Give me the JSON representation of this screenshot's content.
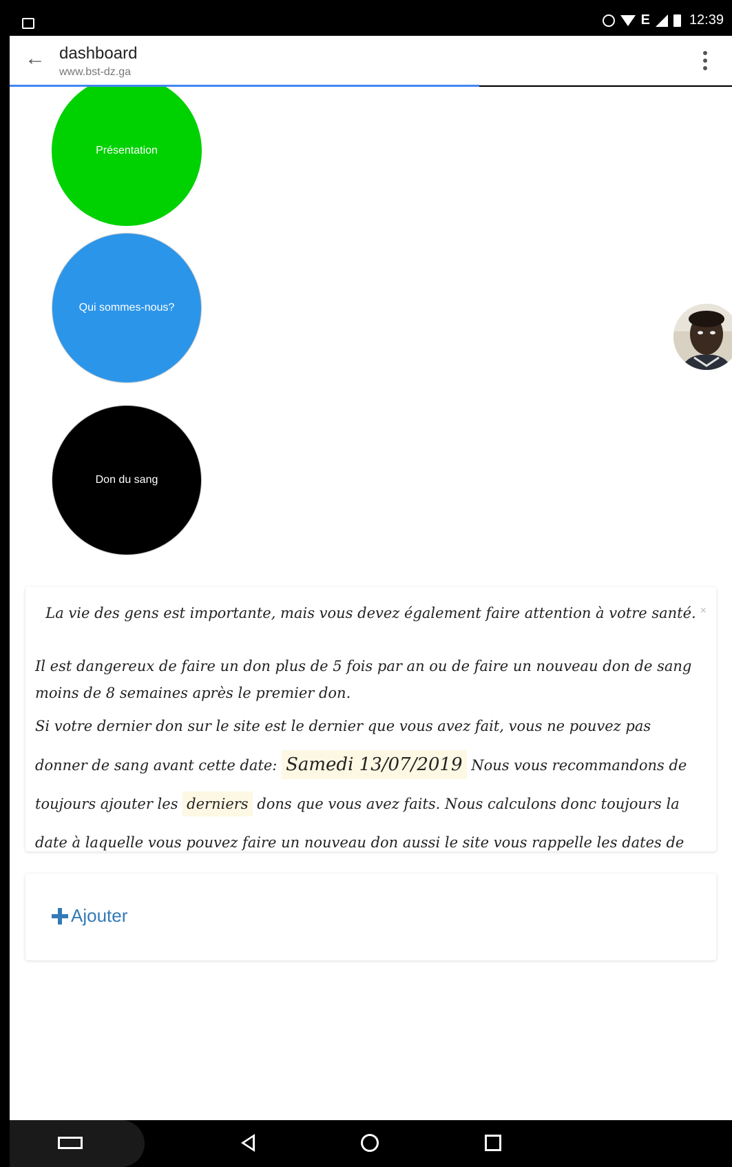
{
  "status_bar": {
    "network": "E",
    "time": "12:39"
  },
  "app_bar": {
    "title": "dashboard",
    "url": "www.bst-dz.ga"
  },
  "circles": {
    "presentation": "Présentation",
    "about": "Qui sommes-nous?",
    "donation": "Don du sang"
  },
  "colors": {
    "presentation": "#00d100",
    "about": "#2b95ea",
    "donation": "#000000",
    "link": "#337ab7",
    "highlight": "#fcf8e3",
    "progress": "#4285f4"
  },
  "alert": {
    "title": "La vie des gens est importante, mais vous devez également faire attention à votre santé.",
    "close": "×",
    "para1": "Il est dangereux de faire un don plus de 5 fois par an ou de faire un nouveau don de sang moins de 8 semaines après le premier don.",
    "para2_start": "Si votre dernier don sur le site est le dernier que vous avez fait, vous ne pouvez pas donner de sang avant cette date:",
    "date": "Samedi 13/07/2019",
    "para2_mid": "Nous vous recommandons de toujours ajouter les",
    "highlight_word": "derniers",
    "para2_end": "dons que vous avez faits. Nous calculons donc toujours la date à laquelle vous pouvez faire un nouveau don aussi le site vous rappelle les dates de vos dons."
  },
  "add": {
    "label": "Ajouter"
  },
  "page_load_progress": 0.65
}
